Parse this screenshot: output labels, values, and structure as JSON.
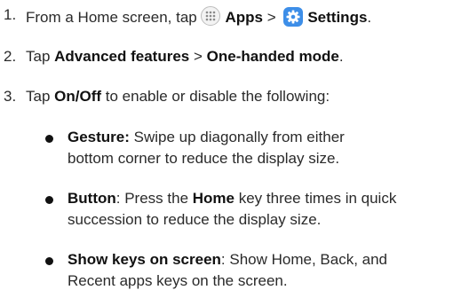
{
  "steps": [
    {
      "num": "1.",
      "prefix": "From a Home screen, tap ",
      "apps_label": "Apps",
      "sep": " > ",
      "settings_label": "Settings",
      "suffix": ".",
      "apps_icon": "apps-grid-icon",
      "settings_icon": "settings-gear-icon"
    },
    {
      "num": "2.",
      "prefix": "Tap ",
      "bold1": "Advanced features",
      "sep": " > ",
      "bold2": "One-handed mode",
      "suffix": "."
    },
    {
      "num": "3.",
      "prefix": "Tap ",
      "bold1": "On/Off",
      "suffix": " to enable or disable the following:"
    }
  ],
  "bullets": [
    {
      "term": "Gesture:",
      "line1": " Swipe up diagonally from either",
      "line2": "bottom corner to reduce the display size."
    },
    {
      "term": "Button",
      "line1_a": ": Press the ",
      "line1_b": "Home",
      "line1_c": " key three times in quick",
      "line2": "succession to reduce the display size."
    },
    {
      "term": "Show keys on screen",
      "line1": ": Show Home, Back, and",
      "line2": "Recent apps keys on the screen."
    }
  ]
}
